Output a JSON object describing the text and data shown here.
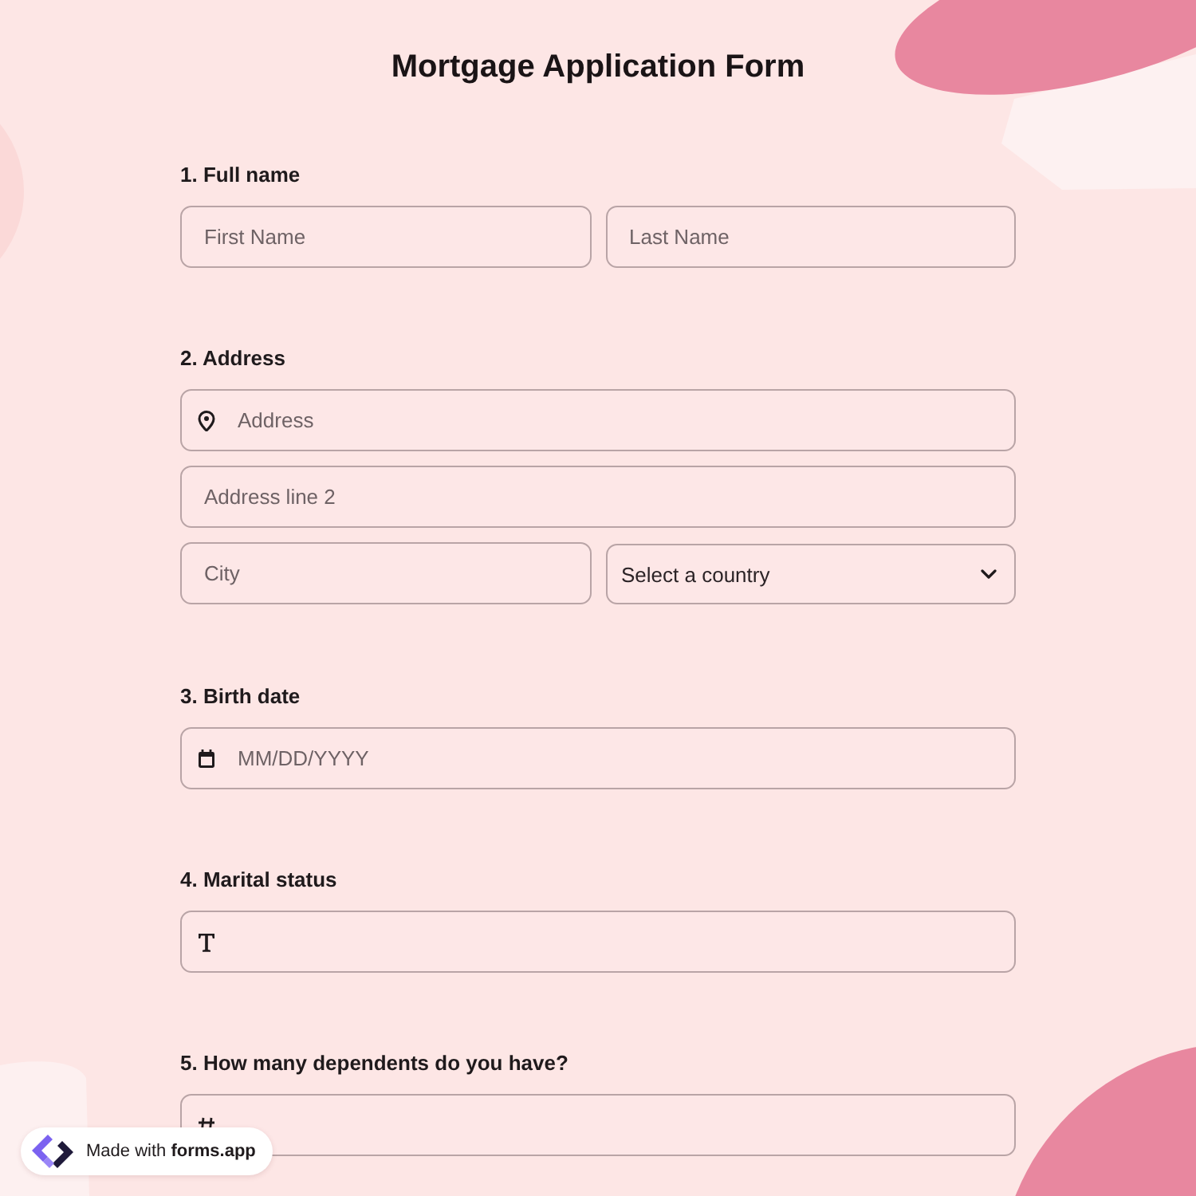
{
  "title": "Mortgage Application Form",
  "questions": [
    {
      "label": "1. Full name",
      "rows": [
        [
          {
            "kind": "text",
            "placeholder": "First Name"
          },
          {
            "kind": "text",
            "placeholder": "Last Name"
          }
        ]
      ]
    },
    {
      "label": "2. Address",
      "rows": [
        [
          {
            "kind": "address",
            "placeholder": "Address"
          }
        ],
        [
          {
            "kind": "text",
            "placeholder": "Address line 2"
          }
        ],
        [
          {
            "kind": "text",
            "placeholder": "City"
          },
          {
            "kind": "select",
            "placeholder": "Select a country"
          }
        ]
      ]
    },
    {
      "label": "3. Birth date",
      "rows": [
        [
          {
            "kind": "date",
            "placeholder": "MM/DD/YYYY"
          }
        ]
      ]
    },
    {
      "label": "4. Marital status",
      "rows": [
        [
          {
            "kind": "short_text"
          }
        ]
      ]
    },
    {
      "label": "5. How many dependents do you have?",
      "rows": [
        [
          {
            "kind": "number"
          }
        ]
      ]
    }
  ],
  "badge": {
    "text": "Made with **forms.app**"
  }
}
